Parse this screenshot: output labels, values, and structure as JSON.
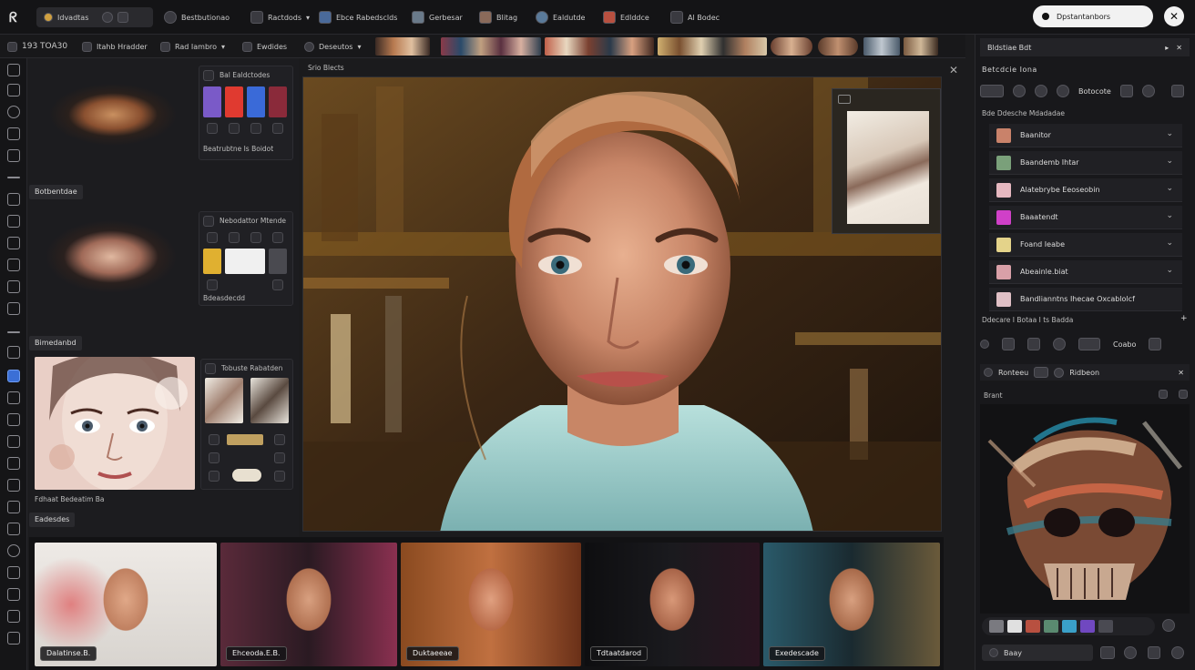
{
  "topbar": {
    "app_label": "Idvadtas",
    "items": [
      "Bestbutionao",
      "Ractdods",
      "Ebce Rabedsclds",
      "Gerbesar",
      "Blitag",
      "Ealdutde",
      "Edlddce",
      "Al Bodec"
    ],
    "pill_label": "Dpstantanbors"
  },
  "toolbar2": {
    "title": "193 TOA30",
    "items": [
      "Itahb Hradder",
      "Rad Iambro",
      "Ewdides",
      "Deseutos"
    ]
  },
  "library": {
    "block1_header": "Bal Ealdctodes",
    "block1_caption": "Beatrubtne Is Boidot",
    "block2_label": "Botbentdae",
    "block2_header": "Nebodattor Mtende",
    "block2_caption": "Bdeasdecdd",
    "block3_label": "Bimedanbd",
    "block3_header": "Tobuste Rabatden",
    "block3_caption": "Fdhaat Bedeatim Ba",
    "block4_label": "Eadesdes"
  },
  "canvas": {
    "breadcrumb": "Srio Blects"
  },
  "filmstrip": {
    "thumbs": [
      "Dalatinse.B.",
      "Ehceoda.E.B.",
      "Duktaeeae",
      "Tdtaatdarod",
      "Exedescade"
    ]
  },
  "right_panel": {
    "tab_title": "Bldstiae Bdt",
    "section_title": "Betcdcie Iona",
    "toolbar_label": "Botocote",
    "group_label": "Bde Ddesche Mdadadae",
    "rows": [
      {
        "label": "Baanitor",
        "color": "#c9826a"
      },
      {
        "label": "Baandemb Ihtar",
        "color": "#7aa07a"
      },
      {
        "label": "Alatebrybe Eeoseobin",
        "color": "#e6b8c0"
      },
      {
        "label": "Baaatendt",
        "color": "#d040c8"
      },
      {
        "label": "Foand Ieabe",
        "color": "#e4d38a"
      },
      {
        "label": "Abeainle.biat",
        "color": "#d9a0a8"
      },
      {
        "label": "Bandlianntns Ihecae Oxcablolcf",
        "color": "#e0c0c6"
      }
    ],
    "layer_header": "Ddecare I Botaa I ts Badda",
    "layer_toolbar": "Coabo",
    "sub_label_left": "Ronteeu",
    "sub_label_right": "Ridbeon",
    "preview_label": "Brant",
    "bottom_label": "Baay",
    "swatches": [
      "#7a7a80",
      "#e0e0e0",
      "#b85040",
      "#5a8a70",
      "#3aa0c8",
      "#7048c0",
      "#4a4a52"
    ]
  },
  "colors": {
    "accent": "#3b6fd6",
    "panel": "#1c1c1f"
  }
}
